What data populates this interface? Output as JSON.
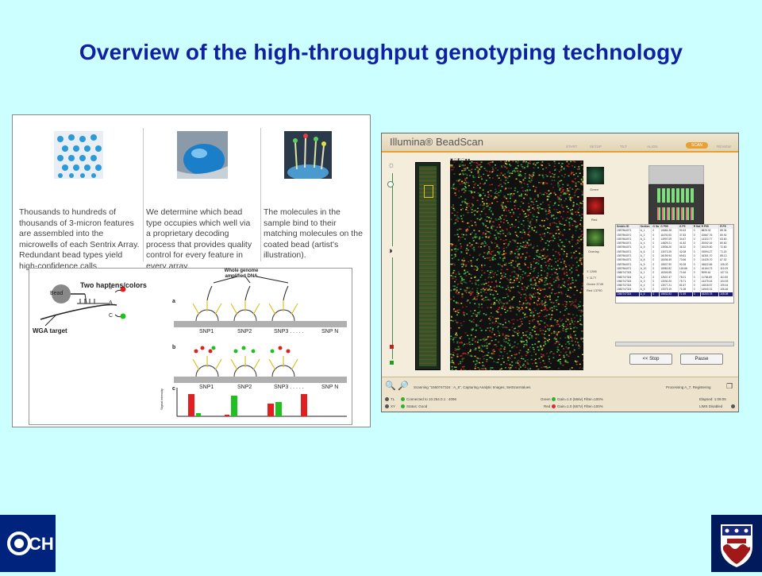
{
  "title": "Overview of the high-throughput genotyping technology",
  "left_figure": {
    "captions": [
      "Thousands to hundreds of thousands of 3-micron features are assembled into the microwells of each Sentrix Array. Redundant bead types yield high-confidence calls.",
      "We determine which bead type occupies which well via a proprietary decoding process that provides quality control for every feature in every array.",
      "The molecules in the sample bind to their matching molecules on the coated bead (artist's illustration)."
    ],
    "diagram": {
      "bead_label": "Bead",
      "haptens_label": "Two haptens/colors",
      "wga_label": "WGA target",
      "whole_genome_label": "Whole genome amplified DNA",
      "panel_a": "a",
      "panel_b": "b",
      "panel_c": "c",
      "snp_labels": [
        "SNP1",
        "SNP2",
        "SNP3 . . . . .",
        "SNP N"
      ],
      "u_label": "U",
      "a_label": "A",
      "c_label": "C",
      "signal_label": "Signal intensity"
    }
  },
  "beadscan": {
    "logo": "Illumina® BeadScan",
    "steps": [
      "START",
      "SETUP",
      "TILT",
      "ALIGN",
      "SCAN",
      "REVIEW"
    ],
    "active_step": "SCAN",
    "swatch_labels": [
      "Green",
      "Red",
      "Overlay"
    ],
    "stats": [
      {
        "label": "X",
        "value": "1266"
      },
      {
        "label": "Y",
        "value": "1177"
      },
      {
        "label": "Green",
        "value": "3749"
      },
      {
        "label": "Red",
        "value": "13790"
      }
    ],
    "table": {
      "headers": [
        "Sentrix ID",
        "Section",
        "G Sat",
        "G P95",
        "G P5",
        "R Sat",
        "R P95",
        "R P5"
      ],
      "rows": [
        [
          "1557964071",
          "A_1",
          "0",
          "10684.28",
          "90.43",
          "0",
          "8825.32",
          "89.34"
        ],
        [
          "1557964071",
          "A_2",
          "0",
          "11676.53",
          "37.83",
          "0",
          "10667.76",
          "80.92"
        ],
        [
          "1557964071",
          "A_3",
          "0",
          "14997.09",
          "34.67",
          "0",
          "14322.77",
          "63.60"
        ],
        [
          "1557964071",
          "A_4",
          "0",
          "14829.21",
          "41.82",
          "0",
          "20002.16",
          "80.60"
        ],
        [
          "1557964071",
          "A_5",
          "0",
          "13936.20",
          "36.32",
          "0",
          "20020.50",
          "72.60"
        ],
        [
          "1557964071",
          "A_6",
          "0",
          "13073.25",
          "42.08",
          "0",
          "19594.27",
          "71.20"
        ],
        [
          "1557964071",
          "A_7",
          "0",
          "16159.94",
          "69.81",
          "0",
          "16301.70",
          "85.13"
        ],
        [
          "1557964071",
          "A_8",
          "0",
          "16036.49",
          "73.56",
          "0",
          "14425.70",
          "87.02"
        ],
        [
          "1557964071",
          "A_9",
          "0",
          "15937.90",
          "90.28",
          "0",
          "16822.65",
          "105.20"
        ],
        [
          "1557964071",
          "A_10",
          "0",
          "15982.82",
          "118.66",
          "0",
          "16164.73",
          "119.29"
        ],
        [
          "1560747324",
          "A_1",
          "0",
          "16349.55",
          "70.46",
          "0",
          "9099.61",
          "107.31"
        ],
        [
          "1560747324",
          "A_2",
          "0",
          "12637.47",
          "75.01",
          "0",
          "11784.89",
          "110.50"
        ],
        [
          "1560747324",
          "A_3",
          "0",
          "13030.20",
          "75.71",
          "0",
          "14475.44",
          "104.93"
        ],
        [
          "1560747324",
          "A_4",
          "0",
          "13077.21",
          "81.67",
          "0",
          "14816.57",
          "109.44"
        ],
        [
          "1560747324",
          "A_5",
          "0",
          "13379.19",
          "71.08",
          "0",
          "14940.31",
          "106.46"
        ],
        [
          "1560747324",
          "A_6",
          "0",
          "15532.83",
          "71.59",
          "0",
          "16203.78",
          "105.08"
        ]
      ]
    },
    "stop_button": "<< Stop",
    "pause_button": "Pause",
    "status": {
      "scanning": "Scanning \"1560747324 : A_6\", Capturing Analytic Images, SetScanValues",
      "processing": "Processing A_7, Registering",
      "connected": "Connected to 10.254.0.1 : 4096",
      "status_good": "Status: Good",
      "green_line": "Green",
      "green_detail": "Gain=1.0 (566v) Filter=100%",
      "red_line": "Red",
      "red_detail": "Gain=1.0 (657v) Filter=100%",
      "elapsed": "Elapsed: 1:09:05",
      "lims": "LIMS Disabled",
      "tl_label": "TL",
      "xy_label": "XY"
    }
  },
  "logos": {
    "chop": "CH",
    "penn_logo": "penn-shield"
  }
}
